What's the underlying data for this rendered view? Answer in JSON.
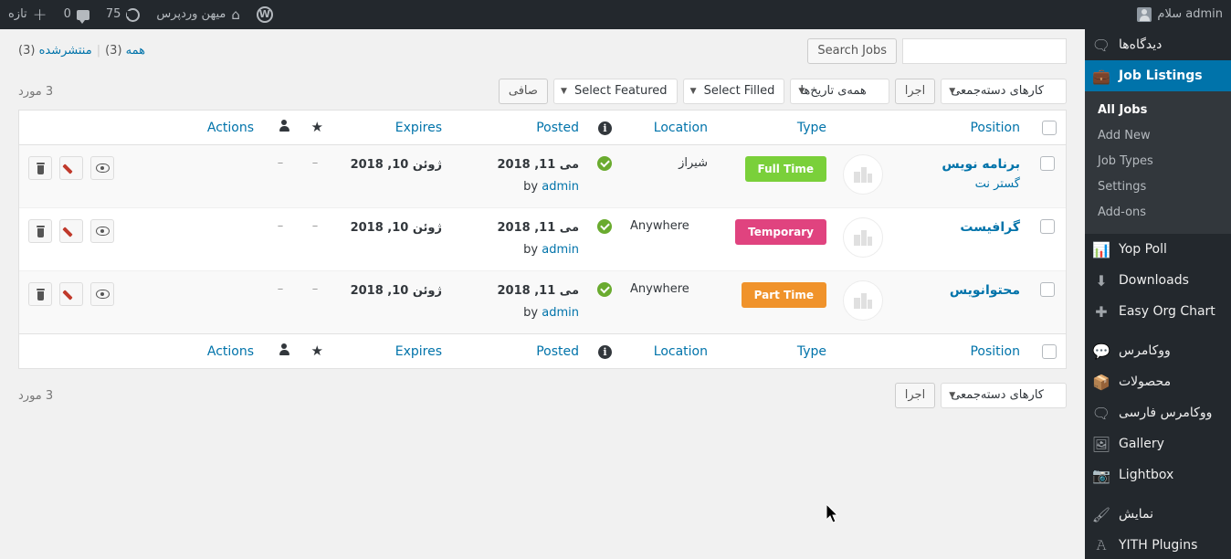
{
  "adminbar": {
    "wp_logo": "wordpress-logo",
    "greeting": "سلام admin",
    "site_name": "میهن وردپرس",
    "comments_count": "0",
    "new_label": "تازه",
    "updates_count": "75"
  },
  "sidebar": {
    "items": [
      {
        "label": "دیدگاه‌ها",
        "icon": "comment-icon",
        "current": false
      },
      {
        "label": "Job Listings",
        "icon": "briefcase-icon",
        "current": true
      },
      {
        "label": "Yop Poll",
        "icon": "chart-icon",
        "current": false
      },
      {
        "label": "Downloads",
        "icon": "download-icon",
        "current": false
      },
      {
        "label": "Easy Org Chart",
        "icon": "plus-icon",
        "current": false
      },
      {
        "label": "ووکامرس",
        "icon": "woo-icon",
        "current": false
      },
      {
        "label": "محصولات",
        "icon": "products-icon",
        "current": false
      },
      {
        "label": "ووکامرس فارسی",
        "icon": "woo-fa-icon",
        "current": false
      },
      {
        "label": "Gallery",
        "icon": "gallery-icon",
        "current": false
      },
      {
        "label": "Lightbox",
        "icon": "lightbox-icon",
        "current": false
      },
      {
        "label": "نمایش",
        "icon": "appearance-icon",
        "current": false
      },
      {
        "label": "YITH Plugins",
        "icon": "yith-icon",
        "current": false
      }
    ],
    "submenu": [
      {
        "label": "All Jobs",
        "current": true
      },
      {
        "label": "Add New",
        "current": false
      },
      {
        "label": "Job Types",
        "current": false
      },
      {
        "label": "Settings",
        "current": false
      },
      {
        "label": "Add-ons",
        "current": false
      }
    ]
  },
  "search": {
    "button_label": "Search Jobs",
    "value": "",
    "placeholder": ""
  },
  "views": {
    "all_label": "همه",
    "all_count": "(3)",
    "published_label": "منتشرشده",
    "published_count": "(3)",
    "separator": "|"
  },
  "toolbar": {
    "bulk_actions_label": "کارهای دسته‌جمعی",
    "apply_label": "اجرا",
    "all_dates_label": "همه‌ی تاریخ‌ها",
    "select_filled_label": "Select Filled",
    "select_featured_label": "Select Featured",
    "filter_label": "صافی",
    "displaying_num": "3 مورد"
  },
  "table": {
    "columns": {
      "checkbox": "",
      "position": "Position",
      "logo": "",
      "type": "Type",
      "location": "Location",
      "filled": "filled-info-icon",
      "posted": "Posted",
      "expires": "Expires",
      "featured": "featured-star-icon",
      "author": "job-author-icon",
      "actions": "Actions"
    },
    "rows": [
      {
        "position": "برنامه نویس",
        "company": "گستر نت",
        "type": "Full Time",
        "type_color": "#7ad03a",
        "location": "شیراز",
        "location_rtl": true,
        "filled": "published-tick",
        "posted": "می 11, 2018",
        "posted_by": "by",
        "posted_author": "admin",
        "expires": "ژوئن 10, 2018",
        "featured": "–",
        "author_flag": "–",
        "actions": [
          "delete-icon",
          "edit-icon",
          "view-icon"
        ]
      },
      {
        "position": "گرافیست",
        "company": "",
        "type": "Temporary",
        "type_color": "#e0437f",
        "location": "Anywhere",
        "location_rtl": false,
        "filled": "published-tick",
        "posted": "می 11, 2018",
        "posted_by": "by",
        "posted_author": "admin",
        "expires": "ژوئن 10, 2018",
        "featured": "–",
        "author_flag": "–",
        "actions": [
          "delete-icon",
          "edit-icon",
          "view-icon"
        ]
      },
      {
        "position": "محتوانویس",
        "company": "",
        "type": "Part Time",
        "type_color": "#f0932b",
        "location": "Anywhere",
        "location_rtl": false,
        "filled": "published-tick",
        "posted": "می 11, 2018",
        "posted_by": "by",
        "posted_author": "admin",
        "expires": "ژوئن 10, 2018",
        "featured": "–",
        "author_flag": "–",
        "actions": [
          "delete-icon",
          "edit-icon",
          "view-icon"
        ]
      }
    ]
  },
  "bottom": {
    "displaying_num": "3 مورد",
    "bulk_actions_label": "کارهای دسته‌جمعی",
    "apply_label": "اجرا"
  },
  "colors": {
    "accent": "#0073aa",
    "sidebar_bg": "#23282d",
    "submenu_bg": "#32373c",
    "page_bg": "#f1f1f1"
  }
}
